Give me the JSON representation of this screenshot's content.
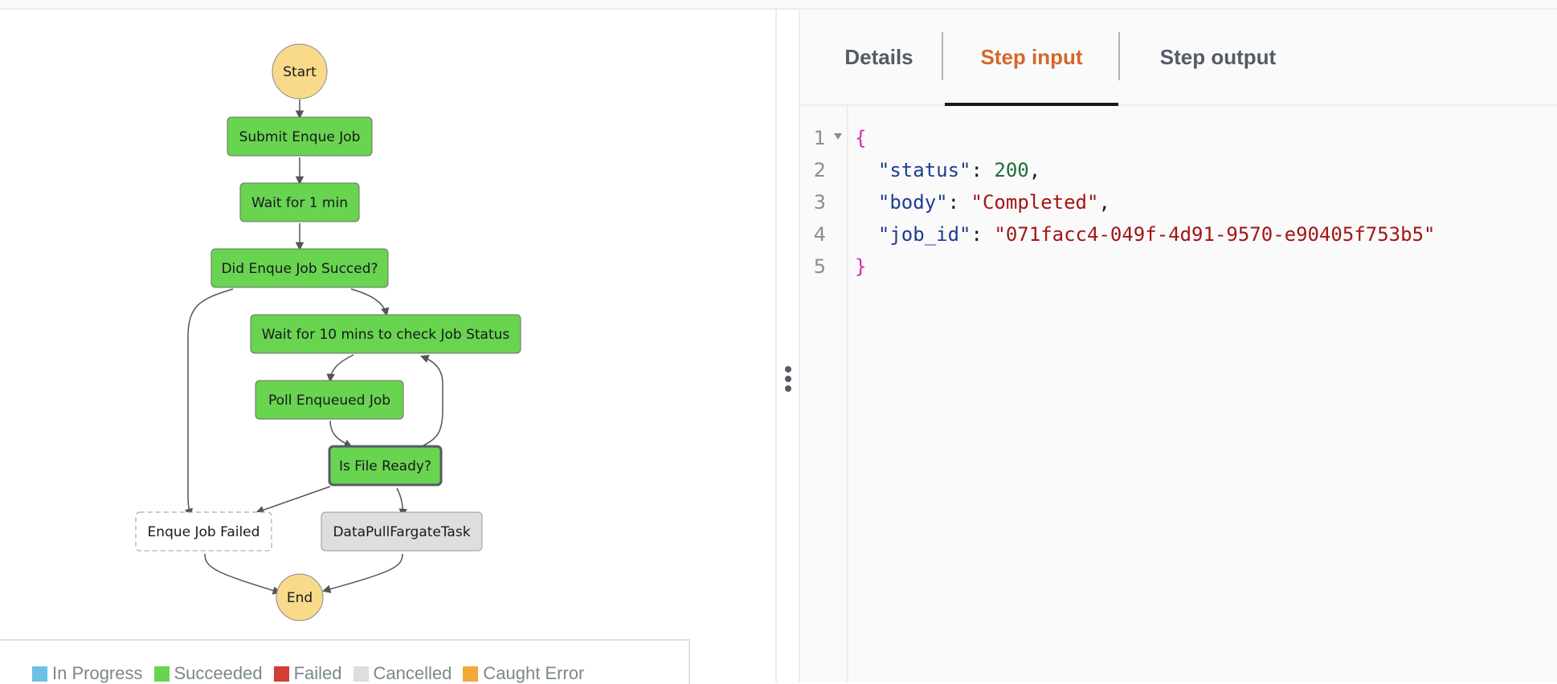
{
  "tabs": [
    {
      "label": "Details",
      "active": false
    },
    {
      "label": "Step input",
      "active": true
    },
    {
      "label": "Step output",
      "active": false
    }
  ],
  "editor": {
    "lines": [
      {
        "n": "1",
        "foldable": true
      },
      {
        "n": "2"
      },
      {
        "n": "3"
      },
      {
        "n": "4"
      },
      {
        "n": "5"
      }
    ],
    "json": {
      "open": "{",
      "close": "}",
      "entries": [
        {
          "key": "\"status\"",
          "value": "200",
          "type": "number",
          "trail": ","
        },
        {
          "key": "\"body\"",
          "value": "\"Completed\"",
          "type": "string",
          "trail": ","
        },
        {
          "key": "\"job_id\"",
          "value": "\"071facc4-049f-4d91-9570-e90405f753b5\"",
          "type": "string",
          "trail": ""
        }
      ]
    }
  },
  "graph": {
    "nodes": [
      {
        "id": "start",
        "label": "Start",
        "kind": "terminal"
      },
      {
        "id": "submit",
        "label": "Submit Enque Job",
        "status": "succeeded"
      },
      {
        "id": "wait1",
        "label": "Wait for 1 min",
        "status": "succeeded"
      },
      {
        "id": "didsucceed",
        "label": "Did Enque Job Succed?",
        "status": "succeeded"
      },
      {
        "id": "wait10",
        "label": "Wait for 10 mins to check Job Status",
        "status": "succeeded"
      },
      {
        "id": "poll",
        "label": "Poll Enqueued Job",
        "status": "succeeded"
      },
      {
        "id": "isready",
        "label": "Is File Ready?",
        "status": "succeeded",
        "selected": true
      },
      {
        "id": "failed",
        "label": "Enque Job Failed",
        "status": "not-run"
      },
      {
        "id": "fargate",
        "label": "DataPullFargateTask",
        "status": "cancelled"
      },
      {
        "id": "end",
        "label": "End",
        "kind": "terminal"
      }
    ],
    "edges": [
      [
        "start",
        "submit"
      ],
      [
        "submit",
        "wait1"
      ],
      [
        "wait1",
        "didsucceed"
      ],
      [
        "didsucceed",
        "wait10"
      ],
      [
        "didsucceed",
        "failed"
      ],
      [
        "wait10",
        "poll"
      ],
      [
        "poll",
        "isready"
      ],
      [
        "isready",
        "wait10"
      ],
      [
        "isready",
        "failed"
      ],
      [
        "isready",
        "fargate"
      ],
      [
        "failed",
        "end"
      ],
      [
        "fargate",
        "end"
      ]
    ]
  },
  "legend": [
    {
      "label": "In Progress",
      "color": "#6bc1e6"
    },
    {
      "label": "Succeeded",
      "color": "#69d44f"
    },
    {
      "label": "Failed",
      "color": "#d13e35"
    },
    {
      "label": "Cancelled",
      "color": "#dedede"
    },
    {
      "label": "Caught Error",
      "color": "#f2a83b"
    }
  ],
  "colors": {
    "succeeded": "#69d44f",
    "cancelled": "#dedede",
    "terminal": "#f9da8a",
    "accent_tab": "#d5662a"
  }
}
